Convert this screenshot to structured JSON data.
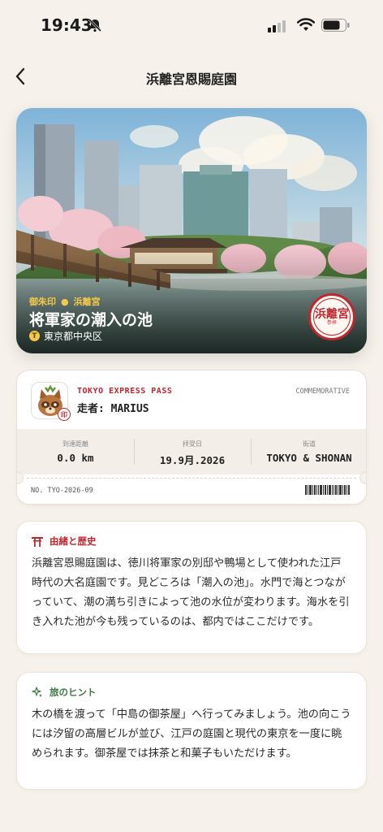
{
  "status_bar": {
    "time": "19:43"
  },
  "nav": {
    "title": "浜離宮恩賜庭園"
  },
  "hero": {
    "tag_primary": "御朱印",
    "tag_secondary": "浜離宮",
    "title": "将軍家の潮入の池",
    "location": "東京都中央区",
    "pin_glyph": "T",
    "stamp_text": "浜離宮",
    "stamp_small": "参拝"
  },
  "ticket": {
    "pass_name": "TOKYO EXPRESS PASS",
    "pass_type": "COMMEMORATIVE",
    "runner": "走者: MARIUS",
    "seal": "印",
    "stats": [
      {
        "label": "到達距離",
        "value": "0.0 km"
      },
      {
        "label": "拝受日",
        "value": "19.9月.2026"
      },
      {
        "label": "街道",
        "value": "TOKYO & SHONAN"
      }
    ],
    "number": "NO. TYO-2026-09"
  },
  "history": {
    "heading": "由緒と歴史",
    "body": "浜離宮恩賜庭園は、徳川将軍家の別邸や鴨場として使われた江戸時代の大名庭園です。見どころは「潮入の池」。水門で海とつながっていて、潮の満ち引きによって池の水位が変わります。海水を引き入れた池が今も残っているのは、都内ではここだけです。"
  },
  "hint": {
    "heading": "旅のヒント",
    "body": "木の橋を渡って「中島の御茶屋」へ行ってみましょう。池の向こうには汐留の高層ビルが並び、江戸の庭園と現代の東京を一度に眺められます。御茶屋では抹茶と和菓子もいただけます。"
  },
  "colors": {
    "accent_red": "#c0262e",
    "accent_gold": "#f4c94a",
    "accent_green": "#3f7a43",
    "background": "#f6f1ea"
  },
  "icons": [
    "bell-slash-icon",
    "signal-icon",
    "wifi-icon",
    "battery-icon",
    "back-chevron-icon",
    "location-pin-icon",
    "torii-icon",
    "sparkle-icon"
  ]
}
